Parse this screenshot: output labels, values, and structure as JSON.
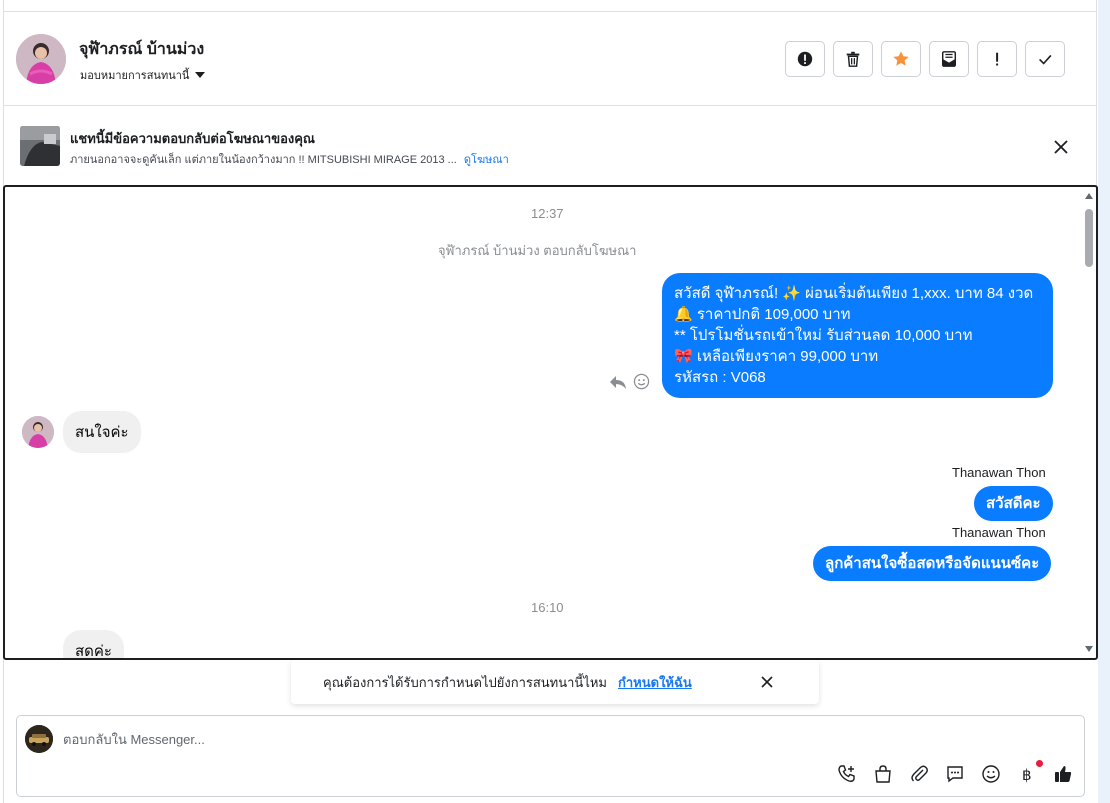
{
  "header": {
    "contact_name": "จุฬ้าภรณ์ บ้านม่วง",
    "assign_label": "มอบหมายการสนทนานี้",
    "actions": [
      {
        "name": "report-spam-button",
        "icon": "exclamation-circle-icon"
      },
      {
        "name": "delete-button",
        "icon": "trash-icon"
      },
      {
        "name": "star-button",
        "icon": "star-icon"
      },
      {
        "name": "mark-unread-button",
        "icon": "envelope-icon"
      },
      {
        "name": "follow-up-button",
        "icon": "exclamation-icon"
      },
      {
        "name": "mark-done-button",
        "icon": "checkmark-icon"
      }
    ],
    "star_color": "#f7923a"
  },
  "ad_banner": {
    "title": "แชทนี้มีข้อความตอบกลับต่อโฆษณาของคุณ",
    "subtitle": "ภายนอกอาจจะดูคันเล็ก แต่ภายในน้องกว้างมาก !! MITSUBISHI MIRAGE 2013 ...",
    "link": "ดูโฆษณา"
  },
  "messages": {
    "time1": "12:37",
    "reply_note": "จุฬ้าภรณ์ บ้านม่วง ตอบกลับโฆษณา",
    "ad_message_lines": [
      "สวัสดี จุฬ้าภรณ์! ✨  ผ่อนเริ่มต้นเพียง 1,xxx. บาท 84 งวด",
      "🔔 ราคาปกติ 109,000 บาท",
      "** โปรโมชั่นรถเข้าใหม่ รับส่วนลด 10,000 บาท",
      "🎀  เหลือเพียงราคา 99,000 บาท",
      " รหัสรถ : V068"
    ],
    "incoming1": "สนใจค่ะ",
    "sender1": "Thanawan Thon",
    "outgoing1": "สวัสดีคะ",
    "sender2": "Thanawan Thon",
    "outgoing2": "ลูกค้าสนใจซื้อสดหรือจัดแนนซ์คะ",
    "time2": "16:10",
    "incoming2": "สดค่ะ"
  },
  "assign_prompt": {
    "text": "คุณต้องการได้รับการกำหนดไปยังการสนทนานี้ไหม",
    "link": "กำหนดให้ฉัน"
  },
  "composer": {
    "placeholder": "ตอบกลับใน Messenger...",
    "tools": [
      "phone-add-icon",
      "shopping-bag-icon",
      "paperclip-icon",
      "chat-bubble-icon",
      "emoji-icon",
      "baht-icon",
      "thumbs-up-icon"
    ],
    "accent_color": "#0a7cff"
  }
}
